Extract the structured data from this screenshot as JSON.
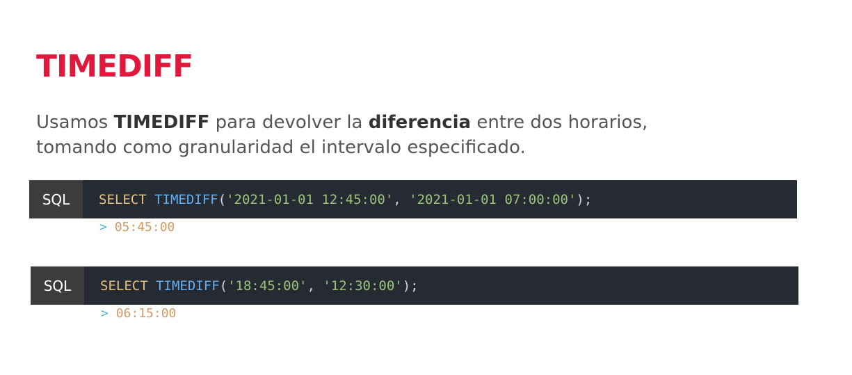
{
  "title": "TIMEDIFF",
  "intro": {
    "part1": "Usamos ",
    "bold1": "TIMEDIFF",
    "part2": " para devolver la ",
    "bold2": "diferencia",
    "part3": " entre dos horarios,",
    "line2": "tomando como granularidad el intervalo especificado."
  },
  "examples": [
    {
      "lang": "SQL",
      "keyword": "SELECT",
      "function": "TIMEDIFF",
      "open": "(",
      "arg1": "'2021-01-01 12:45:00'",
      "sep": ", ",
      "arg2": "'2021-01-01 07:00:00'",
      "close": ");",
      "prompt": ">",
      "result": "05:45:00"
    },
    {
      "lang": "SQL",
      "keyword": "SELECT",
      "function": "TIMEDIFF",
      "open": "(",
      "arg1": "'18:45:00'",
      "sep": ", ",
      "arg2": "'12:30:00'",
      "close": ");",
      "prompt": ">",
      "result": "06:15:00"
    }
  ],
  "colors": {
    "title": "#e0183c",
    "code_background": "#262a33",
    "lang_tab_background": "#3c3c3c",
    "keyword": "#e6c07b",
    "function": "#61afef",
    "string": "#98c379",
    "prompt": "#56b6c2",
    "result": "#d19a66"
  }
}
